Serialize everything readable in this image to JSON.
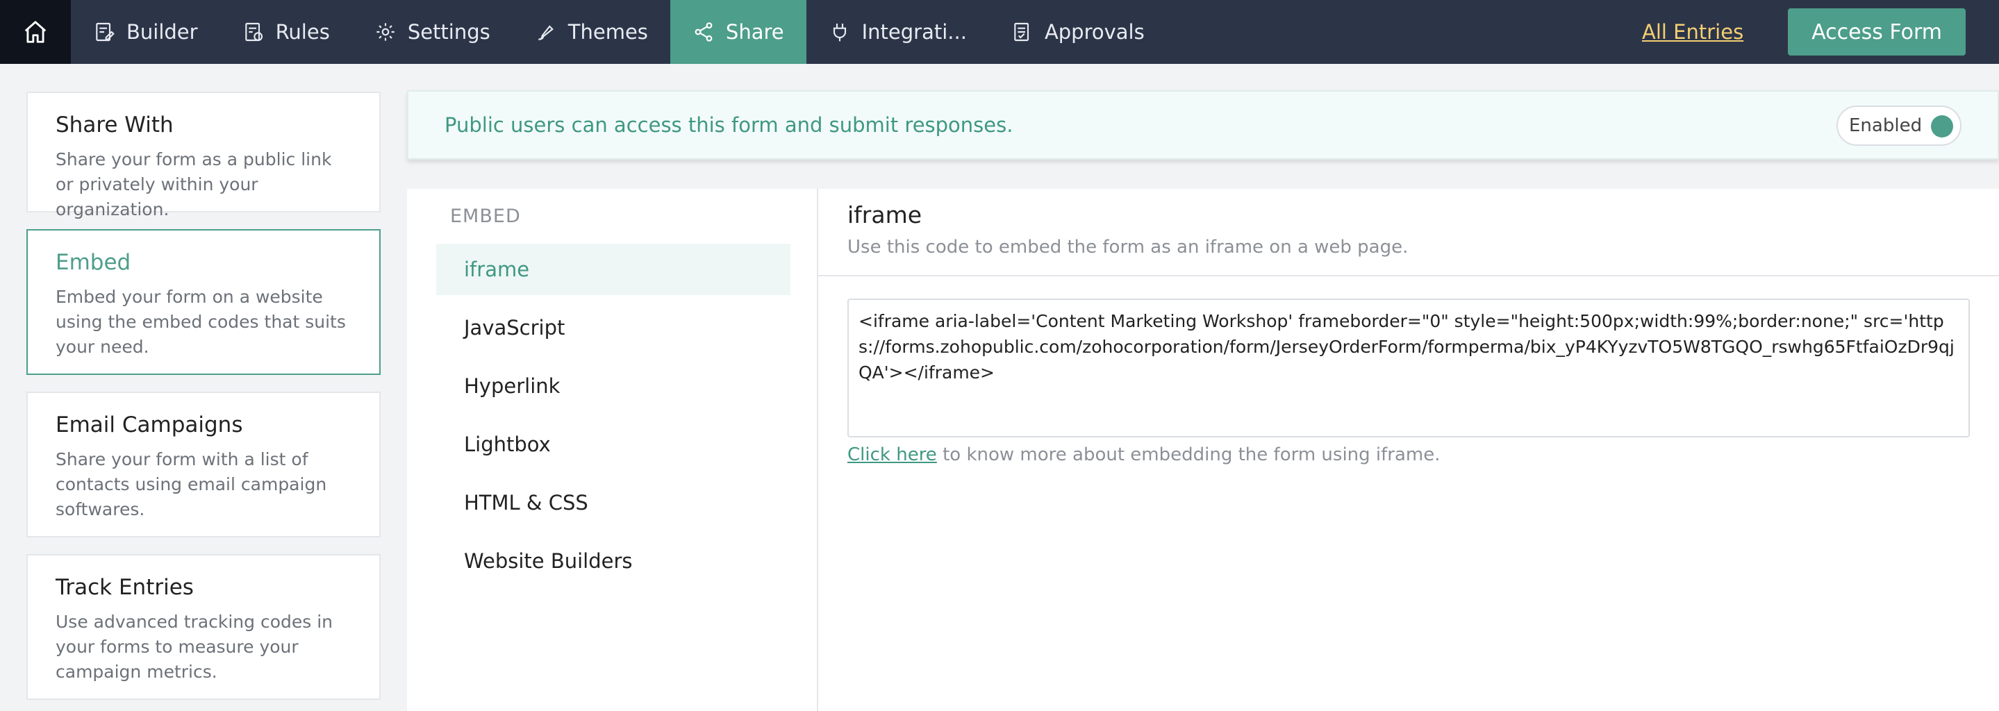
{
  "nav": {
    "items": [
      {
        "label": "Builder",
        "icon": "builder-icon"
      },
      {
        "label": "Rules",
        "icon": "rules-icon"
      },
      {
        "label": "Settings",
        "icon": "gear-icon"
      },
      {
        "label": "Themes",
        "icon": "brush-icon"
      },
      {
        "label": "Share",
        "icon": "share-icon",
        "active": true
      },
      {
        "label": "Integrati...",
        "icon": "plug-icon"
      },
      {
        "label": "Approvals",
        "icon": "approvals-icon"
      }
    ],
    "all_entries": "All Entries",
    "access_form": "Access Form",
    "accent_color": "#4d9e8a",
    "bar_color": "#2c3548"
  },
  "sidebar": {
    "cards": [
      {
        "title": "Share With",
        "desc": "Share your form as a public link or privately within your organization."
      },
      {
        "title": "Embed",
        "desc": "Embed your form on a website using the embed codes that suits your need.",
        "active": true
      },
      {
        "title": "Email Campaigns",
        "desc": "Share your form with a list of contacts using email campaign softwares."
      },
      {
        "title": "Track Entries",
        "desc": "Use advanced tracking codes in your forms to measure your campaign metrics."
      }
    ]
  },
  "banner": {
    "text": "Public users can access this form and submit responses.",
    "toggle_label": "Enabled"
  },
  "embed": {
    "section_label": "EMBED",
    "options": [
      "iframe",
      "JavaScript",
      "Hyperlink",
      "Lightbox",
      "HTML & CSS",
      "Website Builders"
    ],
    "active_option": "iframe",
    "content": {
      "title": "iframe",
      "subtitle": "Use this code to embed the form as an iframe on a web page.",
      "code": "<iframe aria-label='Content Marketing Workshop' frameborder=\"0\" style=\"height:500px;width:99%;border:none;\" src='https://forms.zohopublic.com/zohocorporation/form/JerseyOrderForm/formperma/bix_yP4KYyzvTO5W8TGQO_rswhg65FtfaiOzDr9qjQA'></iframe>",
      "help_link": "Click here",
      "help_text": " to know more about embedding the form using iframe."
    }
  }
}
